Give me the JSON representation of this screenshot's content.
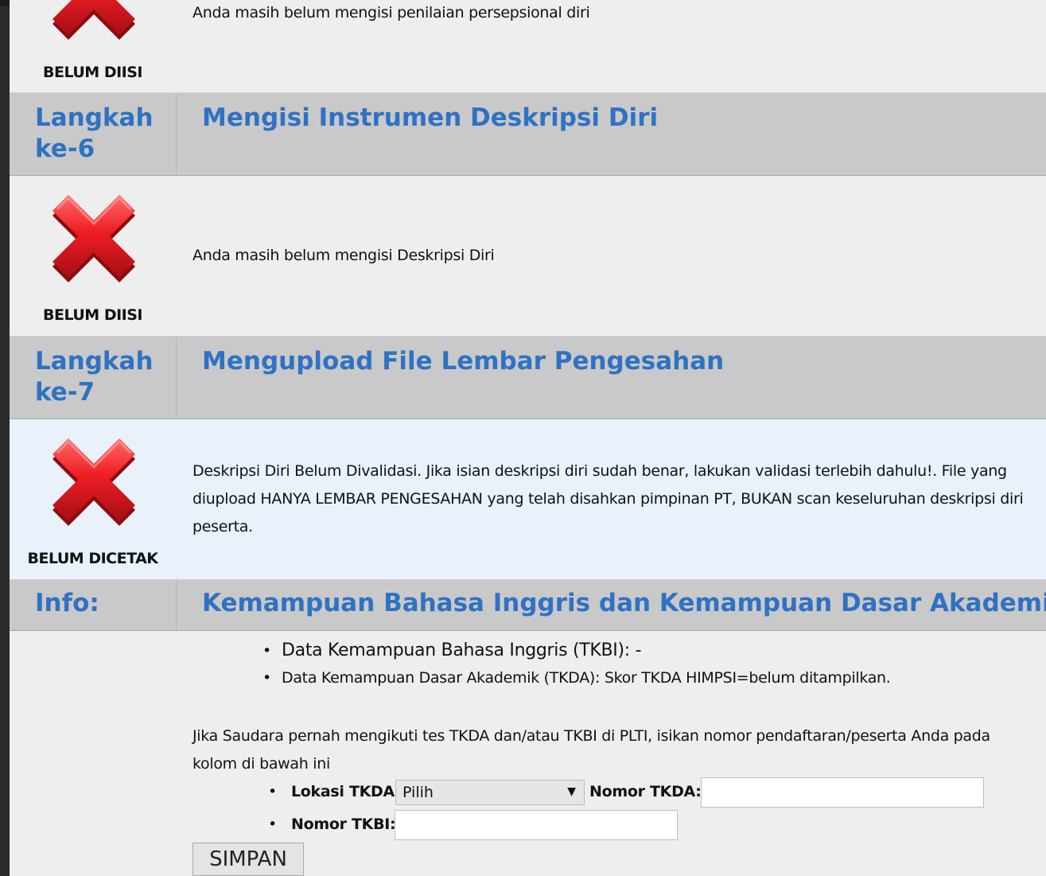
{
  "step5": {
    "status_label": "BELUM DIISI",
    "message": "Anda masih belum mengisi penilaian persepsional diri"
  },
  "step6": {
    "step_label_line1": "Langkah",
    "step_label_line2": "ke-6",
    "title": "Mengisi Instrumen Deskripsi Diri",
    "status_label": "BELUM DIISI",
    "message": "Anda masih belum mengisi Deskripsi Diri"
  },
  "step7": {
    "step_label_line1": "Langkah",
    "step_label_line2": "ke-7",
    "title": "Mengupload File Lembar Pengesahan",
    "status_label": "BELUM DICETAK",
    "message": "Deskripsi Diri Belum Divalidasi. Jika isian deskripsi diri sudah benar, lakukan validasi terlebih dahulu!. File yang diupload HANYA LEMBAR PENGESAHAN yang telah disahkan pimpinan PT, BUKAN scan keseluruhan deskripsi diri peserta."
  },
  "info": {
    "label": "Info:",
    "title": "Kemampuan Bahasa Inggris dan Kemampuan Dasar Akademik",
    "items": [
      "Data Kemampuan Bahasa Inggris (TKBI): -",
      "Data Kemampuan Dasar Akademik (TKDA): Skor TKDA HIMPSI=belum ditampilkan."
    ],
    "note": "Jika Saudara pernah mengikuti tes TKDA dan/atau TKBI di PLTI, isikan nomor pendaftaran/peserta Anda pada kolom di bawah ini",
    "lokasi_label": "Lokasi TKDA:",
    "lokasi_selected": "Pilih",
    "nomor_tkda_label": "Nomor TKDA:",
    "nomor_tkda_value": "",
    "nomor_tkbi_label": "Nomor TKBI:",
    "nomor_tkbi_value": "",
    "save_label": "SIMPAN"
  },
  "icons": {
    "status_icon": "red-x-icon",
    "dropdown_icon": "chevron-down-icon"
  },
  "colors": {
    "heading_blue": "#2f72c4",
    "icon_red": "#e8222a",
    "header_gray": "#c9c9c9"
  }
}
